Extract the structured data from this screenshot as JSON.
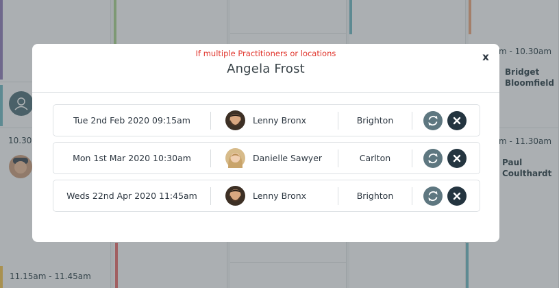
{
  "calendar": {
    "slots": [
      {
        "time": "m - 10.30am",
        "names": [
          "Bridget",
          "Bloomfield"
        ]
      },
      {
        "time": "10.30",
        "names": []
      },
      {
        "time": "m - 11.30am",
        "names": [
          "Paul",
          "Coulthardt"
        ]
      },
      {
        "time": "11.15am - 11.45am",
        "names": []
      }
    ],
    "colors": {
      "purple": "#8e7bb6",
      "green": "#a6cf8c",
      "teal": "#6fb6bf",
      "orange": "#e9a27a",
      "red": "#e36b6b",
      "yellow": "#f2c14e"
    }
  },
  "modal": {
    "note": "If multiple Practitioners or locations",
    "title": "Angela Frost",
    "close_label": "x",
    "appointments": [
      {
        "date": "Tue 2nd Feb 2020 09:15am",
        "practitioner": "Lenny Bronx",
        "location": "Brighton",
        "avatar": "bearded-man"
      },
      {
        "date": "Mon 1st Mar 2020 10:30am",
        "practitioner": "Danielle Sawyer",
        "location": "Carlton",
        "avatar": "blonde-woman"
      },
      {
        "date": "Weds 22nd Apr 2020 11:45am",
        "practitioner": "Lenny Bronx",
        "location": "Brighton",
        "avatar": "bearded-man"
      }
    ],
    "actions": {
      "reschedule_icon": "refresh-icon",
      "cancel_icon": "close-icon"
    }
  }
}
